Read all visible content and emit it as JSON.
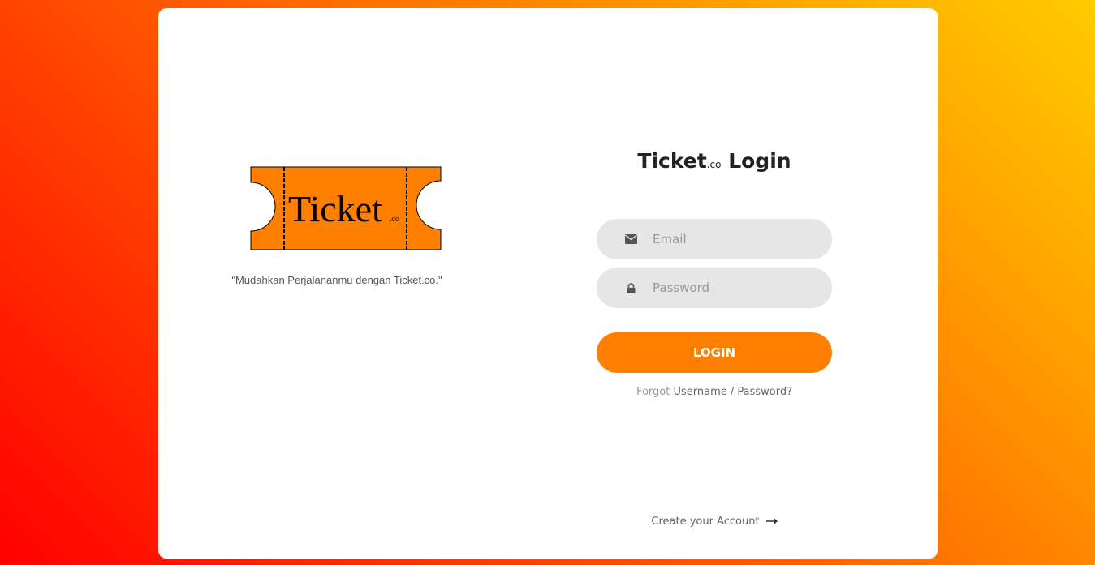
{
  "brand": {
    "logo_text": "Ticket",
    "logo_suffix": ".co",
    "tagline": "\"Mudahkan Perjalananmu dengan Ticket.co.\""
  },
  "login_form": {
    "title_main": "Ticket",
    "title_suffix": ".co",
    "title_rest": "Login",
    "email_placeholder": "Email",
    "password_placeholder": "Password",
    "login_label": "LOGIN",
    "forgot_prefix": "Forgot",
    "forgot_link": "Username / Password?",
    "create_account": "Create your Account",
    "email_icon": "envelope-icon",
    "password_icon": "lock-icon",
    "arrow_icon": "arrow-right-icon"
  },
  "colors": {
    "accent": "#ff8000",
    "input_bg": "#e6e6e6",
    "gradient_start": "#ff0000",
    "gradient_end": "#ffcc00"
  }
}
